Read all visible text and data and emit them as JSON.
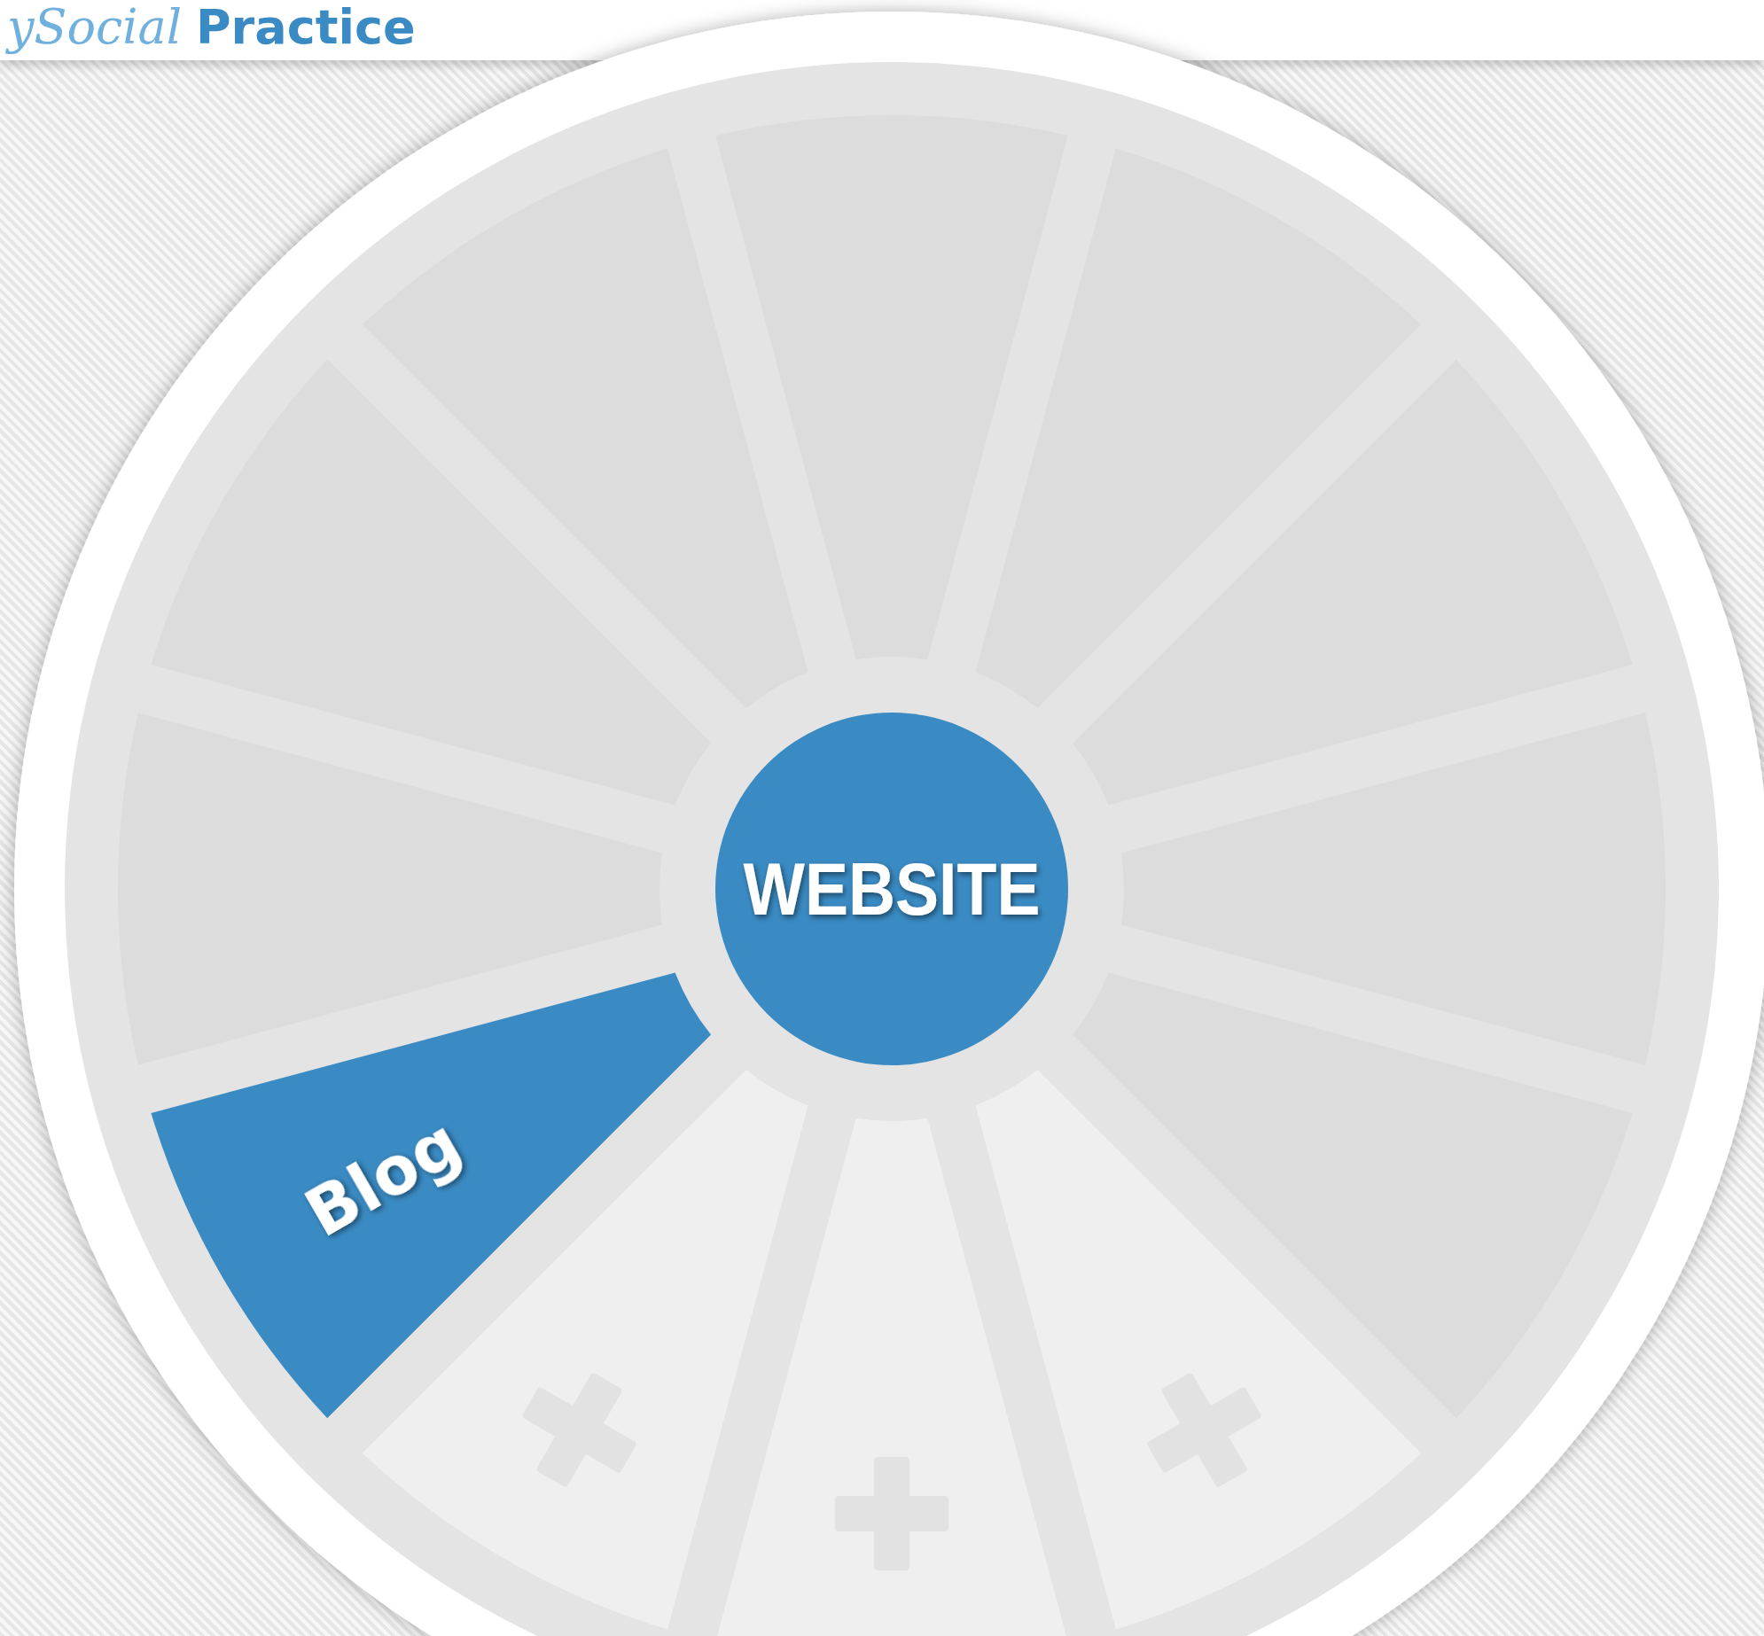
{
  "header": {
    "logo": {
      "script_part": "ySocial",
      "bold_part": "Practice"
    }
  },
  "wheel": {
    "center_label": "WEBSITE",
    "segments": [
      {
        "kind": "empty"
      },
      {
        "kind": "empty"
      },
      {
        "kind": "empty"
      },
      {
        "kind": "empty"
      },
      {
        "kind": "empty"
      },
      {
        "kind": "add"
      },
      {
        "kind": "add"
      },
      {
        "kind": "add"
      },
      {
        "kind": "filled",
        "label": "Blog"
      },
      {
        "kind": "empty"
      },
      {
        "kind": "empty"
      },
      {
        "kind": "empty"
      }
    ]
  }
}
